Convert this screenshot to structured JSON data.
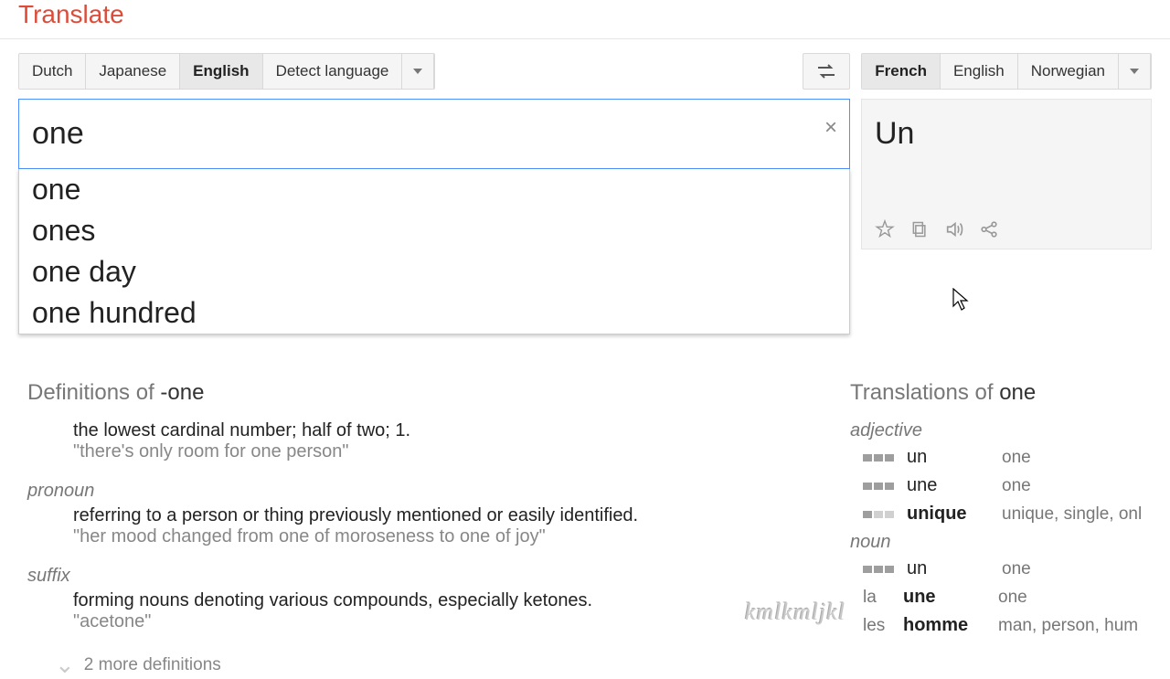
{
  "header": {
    "logo": "Translate"
  },
  "source": {
    "tabs": [
      "Dutch",
      "Japanese",
      "English",
      "Detect language"
    ],
    "active_index": 2,
    "input_value": "one",
    "suggestions": [
      "one",
      "ones",
      "one day",
      "one hundred"
    ]
  },
  "target": {
    "tabs": [
      "French",
      "English",
      "Norwegian"
    ],
    "active_index": 0,
    "output": "Un"
  },
  "definitions": {
    "title_prefix": "Definitions of ",
    "title_word": "-one",
    "entries": [
      {
        "pos": "",
        "text": "the lowest cardinal number; half of two; 1.",
        "example": "\"there's only room for one person\""
      },
      {
        "pos": "pronoun",
        "text": "referring to a person or thing previously mentioned or easily identified.",
        "example": "\"her mood changed from one of moroseness to one of joy\""
      },
      {
        "pos": "suffix",
        "text": "forming nouns denoting various compounds, especially ketones.",
        "example": "\"acetone\""
      }
    ],
    "more": "2 more definitions"
  },
  "translations": {
    "title_prefix": "Translations of ",
    "title_word": "one",
    "groups": [
      {
        "pos": "adjective",
        "rows": [
          {
            "freq": 3,
            "word": "un",
            "bold": false,
            "syn": "one"
          },
          {
            "freq": 3,
            "word": "une",
            "bold": false,
            "syn": "one"
          },
          {
            "freq": 1,
            "word": "unique",
            "bold": true,
            "syn": "unique, single, onl"
          }
        ]
      },
      {
        "pos": "noun",
        "rows": [
          {
            "freq": 3,
            "word": "un",
            "bold": false,
            "article": "",
            "syn": "one"
          },
          {
            "freq": 0,
            "word": "une",
            "bold": true,
            "article": "la",
            "syn": "one"
          },
          {
            "freq": 0,
            "word": "homme",
            "bold": true,
            "article": "les",
            "syn": "man, person, hum"
          }
        ]
      }
    ]
  },
  "watermark": "kmlkmljkl"
}
